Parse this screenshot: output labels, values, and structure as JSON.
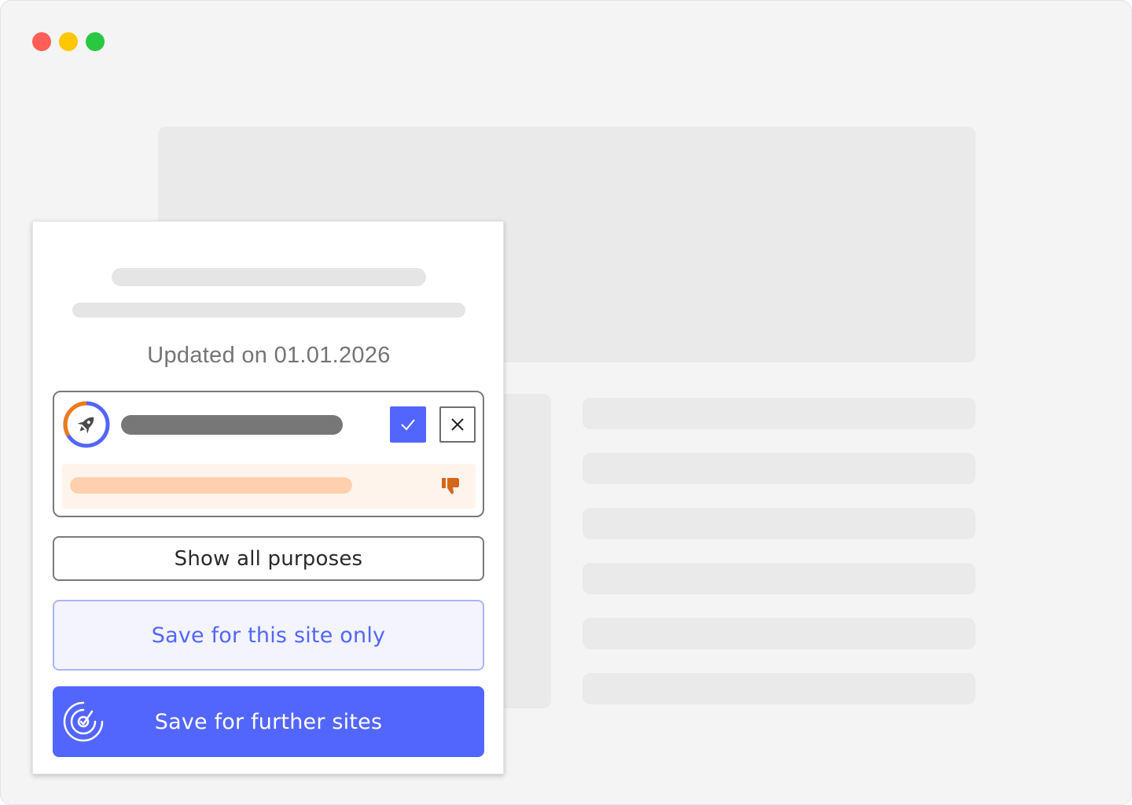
{
  "window": {
    "controls": [
      "close",
      "minimize",
      "maximize"
    ],
    "colors": {
      "close": "#ff5f57",
      "minimize": "#ffc700",
      "maximize": "#28c840"
    }
  },
  "consent": {
    "updated_text": "Updated on 01.01.2026",
    "vendor": {
      "logo_icon": "rocket-icon",
      "accept_icon": "check-icon",
      "reject_icon": "close-icon",
      "warning_icon": "thumbs-down-icon"
    },
    "show_purposes_label": "Show all purposes",
    "save_site_label": "Save for this site only",
    "save_further_label": "Save for further sites",
    "save_further_icon": "radar-check-icon"
  },
  "colors": {
    "accent": "#5266fe",
    "warning": "#d3671a",
    "ring_orange": "#f07a1a"
  }
}
